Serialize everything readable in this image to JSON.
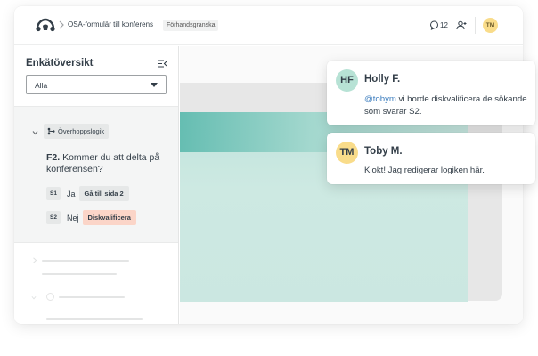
{
  "topbar": {
    "breadcrumb_title": "OSA-formulär till konferens",
    "preview_badge": "Förhandsgranska",
    "comment_count": "12",
    "user_initials": "TM"
  },
  "sidebar": {
    "title": "Enkätöversikt",
    "filter": {
      "selected": "Alla"
    },
    "skip_logic": {
      "label": "Överhoppslogik",
      "question_number": "F2.",
      "question_text": "Kommer du att delta på konferensen?",
      "answers": [
        {
          "code": "S1",
          "text": "Ja",
          "action": "Gå till sida 2"
        },
        {
          "code": "S2",
          "text": "Nej",
          "action": "Diskvalificera"
        }
      ]
    }
  },
  "comments": [
    {
      "initials": "HF",
      "name": "Holly F.",
      "mention": "@tobym",
      "text": " vi borde diskvalificera de sökande som svarar S2."
    },
    {
      "initials": "TM",
      "name": "Toby M.",
      "text": "Klokt! Jag redigerar logiken här."
    }
  ],
  "colors": {
    "avatar_hf": "#b7e2d5",
    "avatar_tm": "#f9dc8a",
    "disqualify_bg": "#fbd5c8",
    "mention": "#3f7fbf",
    "canvas_teal": "#5bb9ad"
  }
}
